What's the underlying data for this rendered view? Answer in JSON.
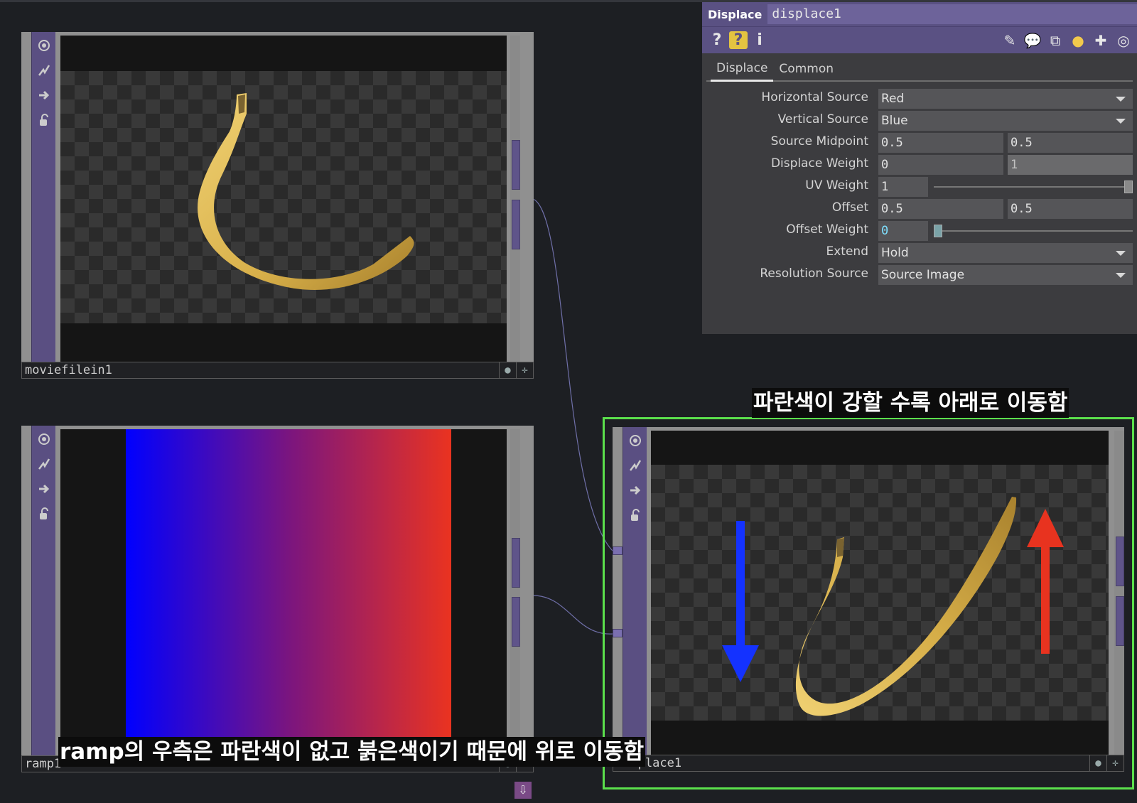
{
  "nodes": {
    "movie": {
      "name": "moviefilein1"
    },
    "ramp": {
      "name": "ramp1",
      "gradient": {
        "left_color": "#0000ff",
        "mid_color": "#7a157f",
        "right_color": "#ea3320"
      }
    },
    "displace": {
      "name": "displace1",
      "selected_border": "#5be04c"
    }
  },
  "captions": {
    "blue_down": "파란색이 강할 수록 아래로 이동함",
    "red_up": "ramp의 우측은 파란색이 없고 붉은색이기 때문에 위로 이동함"
  },
  "arrows": {
    "down_color": "#1432ff",
    "up_color": "#e8331f"
  },
  "panel": {
    "op_type": "Displace",
    "op_name": "displace1",
    "header_icons": [
      "?",
      "?",
      "i"
    ],
    "right_icons": [
      "pencil-icon",
      "comment-icon",
      "clone-icon",
      "python-icon",
      "plus-icon",
      "target-icon"
    ],
    "tabs": [
      "Displace",
      "Common"
    ],
    "params": {
      "horizontal_source": {
        "label": "Horizontal Source",
        "value": "Red"
      },
      "vertical_source": {
        "label": "Vertical Source",
        "value": "Blue"
      },
      "source_midpoint": {
        "label": "Source Midpoint",
        "v1": "0.5",
        "v2": "0.5"
      },
      "displace_weight": {
        "label": "Displace Weight",
        "v1": "0",
        "v2": "1"
      },
      "uv_weight": {
        "label": "UV Weight",
        "v1": "1",
        "slider_fraction": 1.0
      },
      "offset": {
        "label": "Offset",
        "v1": "0.5",
        "v2": "0.5"
      },
      "offset_weight": {
        "label": "Offset Weight",
        "v1": "0",
        "slider_fraction": 0.0
      },
      "extend": {
        "label": "Extend",
        "value": "Hold"
      },
      "resolution_source": {
        "label": "Resolution Source",
        "value": "Source Image"
      }
    }
  }
}
